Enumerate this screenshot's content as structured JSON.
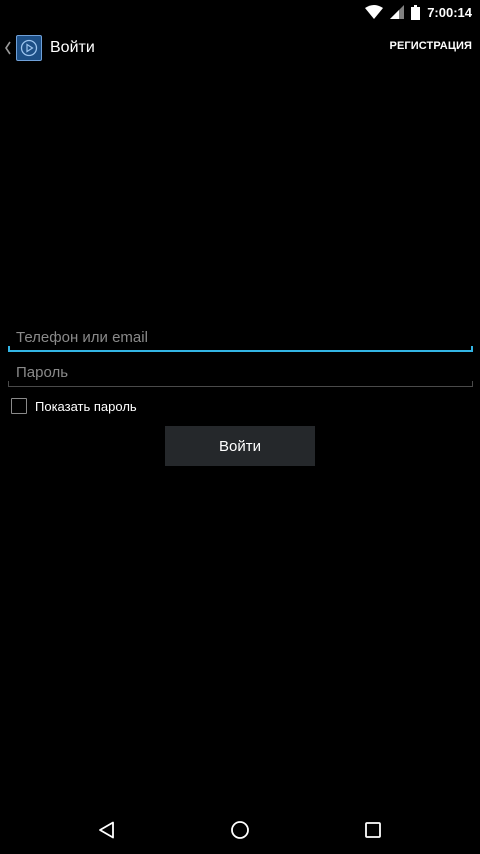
{
  "status_bar": {
    "time": "7:00:14",
    "icons": [
      "wifi-icon",
      "signal-icon",
      "battery-icon"
    ]
  },
  "action_bar": {
    "title": "Войти",
    "register_label": "РЕГИСТРАЦИЯ",
    "icons": [
      "back-chevron-icon",
      "app-logo-icon"
    ]
  },
  "form": {
    "login_placeholder": "Телефон или email",
    "login_value": "",
    "password_placeholder": "Пароль",
    "password_value": "",
    "show_password_label": "Показать пароль",
    "show_password_checked": false,
    "submit_label": "Войти"
  },
  "nav_bar": {
    "icons": [
      "back-icon",
      "home-icon",
      "recents-icon"
    ]
  },
  "colors": {
    "background": "#000000",
    "accent": "#33b5e5",
    "button_bg": "#25282b"
  }
}
